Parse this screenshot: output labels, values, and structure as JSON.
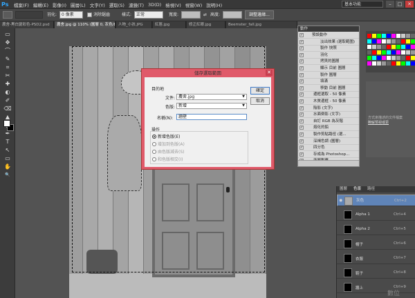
{
  "app": {
    "logo": "Ps"
  },
  "menubar": {
    "menus": [
      "檔案(F)",
      "編輯(E)",
      "影像(I)",
      "圖層(L)",
      "文字(Y)",
      "選取(S)",
      "濾鏡(T)",
      "3D(D)",
      "檢視(V)",
      "視窗(W)",
      "說明(H)"
    ],
    "workspace": "基本功能",
    "min": "–",
    "max": "□",
    "close": "✕"
  },
  "options": {
    "feather_label": "羽化:",
    "feather_value": "0 像素",
    "antialias_label": "消除鋸齒",
    "style_label": "樣式:",
    "style_value": "正常",
    "width_label": "寬度:",
    "height_label": "高度:",
    "refine_button": "調整邊緣..."
  },
  "tabs": [
    "農舍-黑白變彩色-PSD2.psd",
    "農舍.jpg @ 110% (圖層 0, 灰色/8*) *",
    "人物_小孩.JPG",
    "紅唇.jpg",
    "修正紅眼.jpg",
    "Beemster_fall.jpg"
  ],
  "tools": [
    "▭",
    "✥",
    "⌒",
    "✎",
    "⌗",
    "✂",
    "✚",
    "◐",
    "✐",
    "⌫",
    "▲",
    "●",
    "✒",
    "T",
    "↖",
    "▭",
    "✋",
    "🔍"
  ],
  "dialog": {
    "title": "儲存選取範圍",
    "close": "✕",
    "target_label": "目的地",
    "document_label": "文件:",
    "document_value": "農舍.jpg",
    "channel_label": "色版:",
    "channel_value": "新增",
    "name_label": "名稱(N):",
    "name_value": "牆壁",
    "operation_label": "操作",
    "ok": "確定",
    "cancel": "取消",
    "ops": [
      {
        "label": "新增色版(E)",
        "enabled": true,
        "selected": true
      },
      {
        "label": "增加到色版(A)",
        "enabled": false,
        "selected": false
      },
      {
        "label": "由色版減去(S)",
        "enabled": false,
        "selected": false
      },
      {
        "label": "和色版相交(I)",
        "enabled": false,
        "selected": false
      }
    ]
  },
  "actions": {
    "header": "動作",
    "rows": [
      {
        "check": "✓",
        "text": "預設動作"
      },
      {
        "check": "✓",
        "text": "淡出效果 (選取範圍)"
      },
      {
        "check": "✓",
        "text": "製作 快照"
      },
      {
        "check": "✓",
        "text": "羽化"
      },
      {
        "check": "✓",
        "text": "拷貝的圖層"
      },
      {
        "check": "✓",
        "text": "顯示 目前 圖層"
      },
      {
        "check": "✓",
        "text": "製作 圖層"
      },
      {
        "check": "✓",
        "text": "填滿"
      },
      {
        "check": "✓",
        "text": "移動 目前 圖層"
      },
      {
        "check": "✓",
        "text": "邊框選取 - 50 像素"
      },
      {
        "check": "✓",
        "text": "木質邊框 - 50 像素"
      },
      {
        "check": "✓",
        "text": "陰影 (文字)"
      },
      {
        "check": "✓",
        "text": "水面倒影 (文字)"
      },
      {
        "check": "✓",
        "text": "自訂 RGB 為灰階"
      },
      {
        "check": "✓",
        "text": "熔化的鉛"
      },
      {
        "check": "✓",
        "text": "製作剪貼路徑 (選..."
      },
      {
        "check": "✓",
        "text": "深褐色調 (圖層)"
      },
      {
        "check": "✓",
        "text": "四分色"
      },
      {
        "check": "✓",
        "text": "存成為 Photoshop..."
      },
      {
        "check": "✓",
        "text": "漸層對應"
      }
    ]
  },
  "right_panel": {
    "text1": "方式來描述的文件檔案",
    "text2": "瞭解預視或更"
  },
  "channels": {
    "tabs": [
      "圖層",
      "色版",
      "路徑"
    ],
    "rows": [
      {
        "name": "灰色",
        "shortcut": "Ctrl+2",
        "selected": true
      },
      {
        "name": "Alpha 1",
        "shortcut": "Ctrl+4",
        "selected": false
      },
      {
        "name": "Alpha 2",
        "shortcut": "Ctrl+5",
        "selected": false
      },
      {
        "name": "帽子",
        "shortcut": "Ctrl+6",
        "selected": false
      },
      {
        "name": "衣服",
        "shortcut": "Ctrl+7",
        "selected": false
      },
      {
        "name": "鞋子",
        "shortcut": "Ctrl+8",
        "selected": false
      },
      {
        "name": "牆上",
        "shortcut": "Ctrl+9",
        "selected": false
      }
    ]
  },
  "watermark": "數位"
}
